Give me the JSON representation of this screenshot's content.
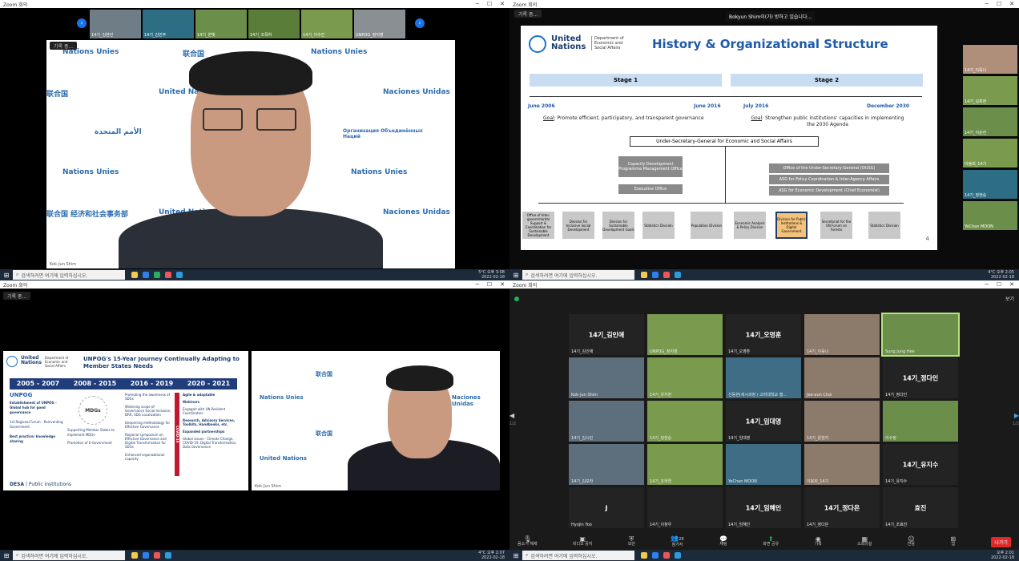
{
  "q1": {
    "title": "Zoom 회의",
    "rec_label": "기록 중...",
    "thumbnails": [
      {
        "name": "14기_김현진"
      },
      {
        "name": "14기_김민주"
      },
      {
        "name": "14기_한빛"
      },
      {
        "name": "14기_조목하"
      },
      {
        "name": "14기_이수진"
      },
      {
        "name": "UNPOG_정지영"
      }
    ],
    "speaker_name": "Kok-Jun Shim",
    "un_tiles": [
      "United Nations",
      "Nations Unies",
      "联合国",
      "Naciones Unidas",
      "الأمم المتحدة",
      "Организация Объединённых Наций",
      "经济和社会事务部"
    ],
    "taskbar": {
      "search": "검색하려면 여기에 입력하십시오.",
      "temp": "5°C",
      "time": "오후 3:08",
      "date": "2022-02-18"
    }
  },
  "q2": {
    "title": "Zoom 회의",
    "rec_label": "기록 중...",
    "chat_toast": "Bokyun Shim이(가) 방하고 있습니다...",
    "slide": {
      "logo_main": "United Nations",
      "logo_dept": "Department of Economic and Social Affairs",
      "heading": "History & Organizational Structure",
      "stage1": "Stage 1",
      "stage2": "Stage 2",
      "date1": "June 2006",
      "date2": "June 2016",
      "date3": "July 2016",
      "date4": "December 2030",
      "goal_label": "Goal",
      "goal1": ": Promote efficient, participatory, and transparent governance",
      "goal2": ": Strengthen public institutions' capacities in implementing the 2030 Agenda",
      "usg": "Under-Secretary-General for Economic and Social Affairs",
      "capdev": "Capacity Development Programme Management Office",
      "exec": "Executive Office",
      "ousg": "Office of the Under-Secretary-General (OUSG)",
      "asg1": "ASG for Policy Coordination & Inter-Agency Affairs",
      "asg2": "ASG for Economic Development (Chief Economist)",
      "divisions": [
        "Office of Inter-governmental Support & Coordination for Sustainable Development",
        "Division for Inclusive Social Development",
        "Division for Sustainable Development Goals",
        "Statistics Division",
        "Population Division",
        "Economic Analysis & Policy Division",
        "Division for Public Institutions & Digital Government",
        "Secretariat for the UN Forum on Forests",
        "Statistics Division"
      ],
      "page": "4"
    },
    "side_thumbs": [
      "14기_이육나",
      "14기_김희현",
      "14기_이순진",
      "이봉희_14기",
      "14기_정현승",
      "YeChan MOON"
    ],
    "taskbar": {
      "search": "검색하려면 여기에 입력하십시오.",
      "temp": "4°C",
      "time": "오후 2:05",
      "date": "2022-02-18"
    }
  },
  "q3": {
    "title": "Zoom 회의",
    "rec_label": "기록 중...",
    "slide": {
      "logo_main": "United Nations",
      "logo_dept": "Department of Economic and Social Affairs",
      "heading": "UNPOG's 15-Year Journey Continually Adapting to Member States Needs",
      "periods": [
        "2005 - 2007",
        "2008 - 2015",
        "2016 - 2019",
        "2020 - 2021"
      ],
      "col1": [
        "UNPOG",
        "Establishment of UNPOG - Global hub for good governance",
        "1st Regional Forum - Reinventing Government",
        "Best practice/ knowledge sharing"
      ],
      "col2": [
        "MDGs",
        "Supporting Member States to implement MDGs",
        "Promotion of E-Government"
      ],
      "col3": [
        "Promoting the awareness of SDGs",
        "Widening scope of Governance Social Inclusion, DRR, SDG Localization",
        "Deepening methodology for Effective Governance",
        "Regional symposium on Effective Governance and Digital Transformation for SDGs",
        "Enhanced organizational capacity"
      ],
      "covid": "COVID-19",
      "col4": [
        "Agile & adaptable",
        "Webinars",
        "Engaged with UN Resident Coordinators",
        "Research, Advisory Services, Toolkits, Handbooks, etc.",
        "Expanded partnerships",
        "Global issues - Climate Change, COVID-19, Digital Transformation, Data Governance"
      ],
      "footer_desa": "DESA",
      "footer_pi": "Public Institutions"
    },
    "speaker_name": "Kok-Jun Shim",
    "taskbar": {
      "search": "검색하려면 여기에 입력하십시오.",
      "temp": "4°C",
      "time": "오후 2:07",
      "date": "2022-02-18"
    }
  },
  "q4": {
    "title": "Zoom 회의",
    "view_label": "보기",
    "gallery": [
      {
        "label": "14기_김인애",
        "name": "14기_김인애",
        "video": false
      },
      {
        "label": "",
        "name": "UNPOG_정지영",
        "video": true
      },
      {
        "label": "14기_오영훈",
        "name": "14기_오영훈",
        "video": false
      },
      {
        "label": "",
        "name": "14기_이육나",
        "video": true
      },
      {
        "label": "",
        "name": "Sung Jung Hee",
        "video": true,
        "active": true
      },
      {
        "label": "",
        "name": "Kok-Jun Shim",
        "video": true
      },
      {
        "label": "",
        "name": "14기_유지현",
        "video": true
      },
      {
        "label": "",
        "name": "신동현(세시과정 / 고려대학교 행...",
        "video": true
      },
      {
        "label": "",
        "name": "Jee-eun Choi",
        "video": true
      },
      {
        "label": "14기_정다인",
        "name": "14기_정다인",
        "video": false
      },
      {
        "label": "",
        "name": "14기_김시진",
        "video": true
      },
      {
        "label": "",
        "name": "14기_정현승",
        "video": true
      },
      {
        "label": "14기_임대영",
        "name": "14기_임대영",
        "video": false
      },
      {
        "label": "",
        "name": "14기_윤현지",
        "video": true
      },
      {
        "label": "",
        "name": "이수정",
        "video": true
      },
      {
        "label": "",
        "name": "14기_김보라",
        "video": true
      },
      {
        "label": "",
        "name": "14기_조하연",
        "video": true
      },
      {
        "label": "",
        "name": "YeChan MOON",
        "video": true
      },
      {
        "label": "",
        "name": "이봉희_14기",
        "video": true
      },
      {
        "label": "14기_유지수",
        "name": "14기_유지수",
        "video": false
      },
      {
        "label": "J",
        "name": "Hyojin Yoo",
        "video": false
      },
      {
        "label": "",
        "name": "14기_이창우",
        "video": false
      },
      {
        "label": "14기_임혜인",
        "name": "14기_임혜인",
        "video": false
      },
      {
        "label": "14기_정다은",
        "name": "14기_정다은",
        "video": false
      },
      {
        "label": "효진",
        "name": "14기_조효진",
        "video": false
      }
    ],
    "page_left": "1/2",
    "page_right": "1/2",
    "toolbar": [
      "음소거 해제",
      "비디오 중지",
      "보안",
      "참가자",
      "채팅",
      "화면 공유",
      "기록",
      "소회의실",
      "반응",
      "앱"
    ],
    "participants_count": "28",
    "leave": "나가기",
    "taskbar": {
      "search": "검색하려면 여기에 입력하십시오.",
      "time": "오후 2:01",
      "date": "2022-02-18"
    }
  }
}
